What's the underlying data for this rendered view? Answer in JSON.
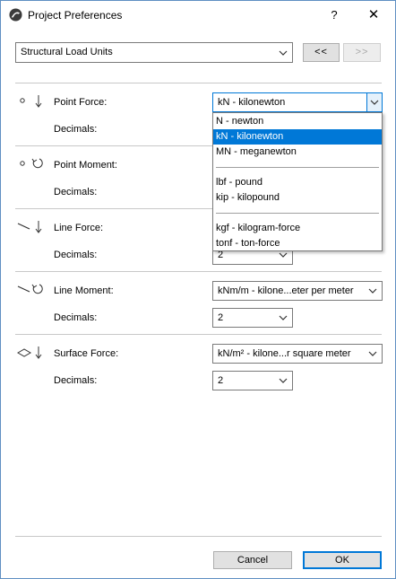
{
  "window": {
    "title": "Project Preferences",
    "help": "?",
    "close": "✕"
  },
  "category_select": {
    "value": "Structural Load Units"
  },
  "nav": {
    "prev": "<<",
    "next": ">>"
  },
  "rows": {
    "point_force": {
      "label": "Point Force:",
      "unit": "kN - kilonewton",
      "decimals_label": "Decimals:"
    },
    "point_moment": {
      "label": "Point Moment:",
      "decimals_label": "Decimals:"
    },
    "line_force": {
      "label": "Line Force:",
      "decimals_label": "Decimals:",
      "decimals": "2"
    },
    "line_moment": {
      "label": "Line Moment:",
      "unit": "kNm/m - kilone...eter per meter",
      "decimals_label": "Decimals:",
      "decimals": "2"
    },
    "surface_force": {
      "label": "Surface Force:",
      "unit": "kN/m² - kilone...r square meter",
      "decimals_label": "Decimals:",
      "decimals": "2"
    }
  },
  "dropdown": {
    "items": [
      "N - newton",
      "kN - kilonewton",
      "MN - meganewton",
      "lbf - pound",
      "kip - kilopound",
      "kgf - kilogram-force",
      "tonf - ton-force"
    ],
    "selected": "kN - kilonewton"
  },
  "buttons": {
    "cancel": "Cancel",
    "ok": "OK"
  },
  "colors": {
    "selection": "#0078d7",
    "focus_border": "#0078d7",
    "button_face": "#e1e1e1"
  },
  "icons": [
    "app-logo-icon",
    "help-icon",
    "close-icon",
    "chevron-down-icon",
    "point-force-icon",
    "point-moment-icon",
    "line-force-icon",
    "line-moment-icon",
    "surface-force-icon"
  ]
}
